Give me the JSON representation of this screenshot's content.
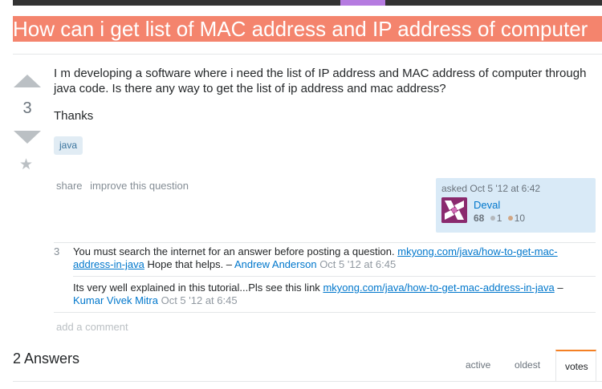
{
  "question": {
    "title": "How can i get list of MAC address and IP address of computer",
    "vote_count": "3",
    "body_p1": "I m developing a software where i need the list of IP address and MAC address of computer through java code. Is there any way to get the list of ip address and mac address?",
    "body_p2": "Thanks",
    "tags": [
      "java"
    ],
    "menu": {
      "share": "share",
      "improve": "improve this question"
    },
    "asked": "asked Oct 5 '12 at 6:42",
    "user": {
      "name": "Deval",
      "reputation": "68",
      "silver": "1",
      "bronze": "10"
    }
  },
  "comments": [
    {
      "score": "3",
      "text": "You must search the internet for an answer before posting a question.",
      "link": "mkyong.com/java/how-to-get-mac-address-in-java",
      "suffix": "Hope that helps. –",
      "user": "Andrew Anderson",
      "date": "Oct 5 '12 at 6:45"
    },
    {
      "score": "",
      "text": "Its very well explained in this tutorial...Pls see this link",
      "link": "mkyong.com/java/how-to-get-mac-address-in-java",
      "suffix": "–",
      "user": "Kumar Vivek Mitra",
      "date": "Oct 5 '12 at 6:45"
    }
  ],
  "add_comment": "add a comment",
  "answers": {
    "heading": "2 Answers",
    "tabs": [
      "active",
      "oldest",
      "votes"
    ],
    "active_tab": "votes"
  },
  "colors": {
    "title_bg": "#f4846d",
    "link": "#0077cc",
    "tab_accent": "#f48024"
  }
}
